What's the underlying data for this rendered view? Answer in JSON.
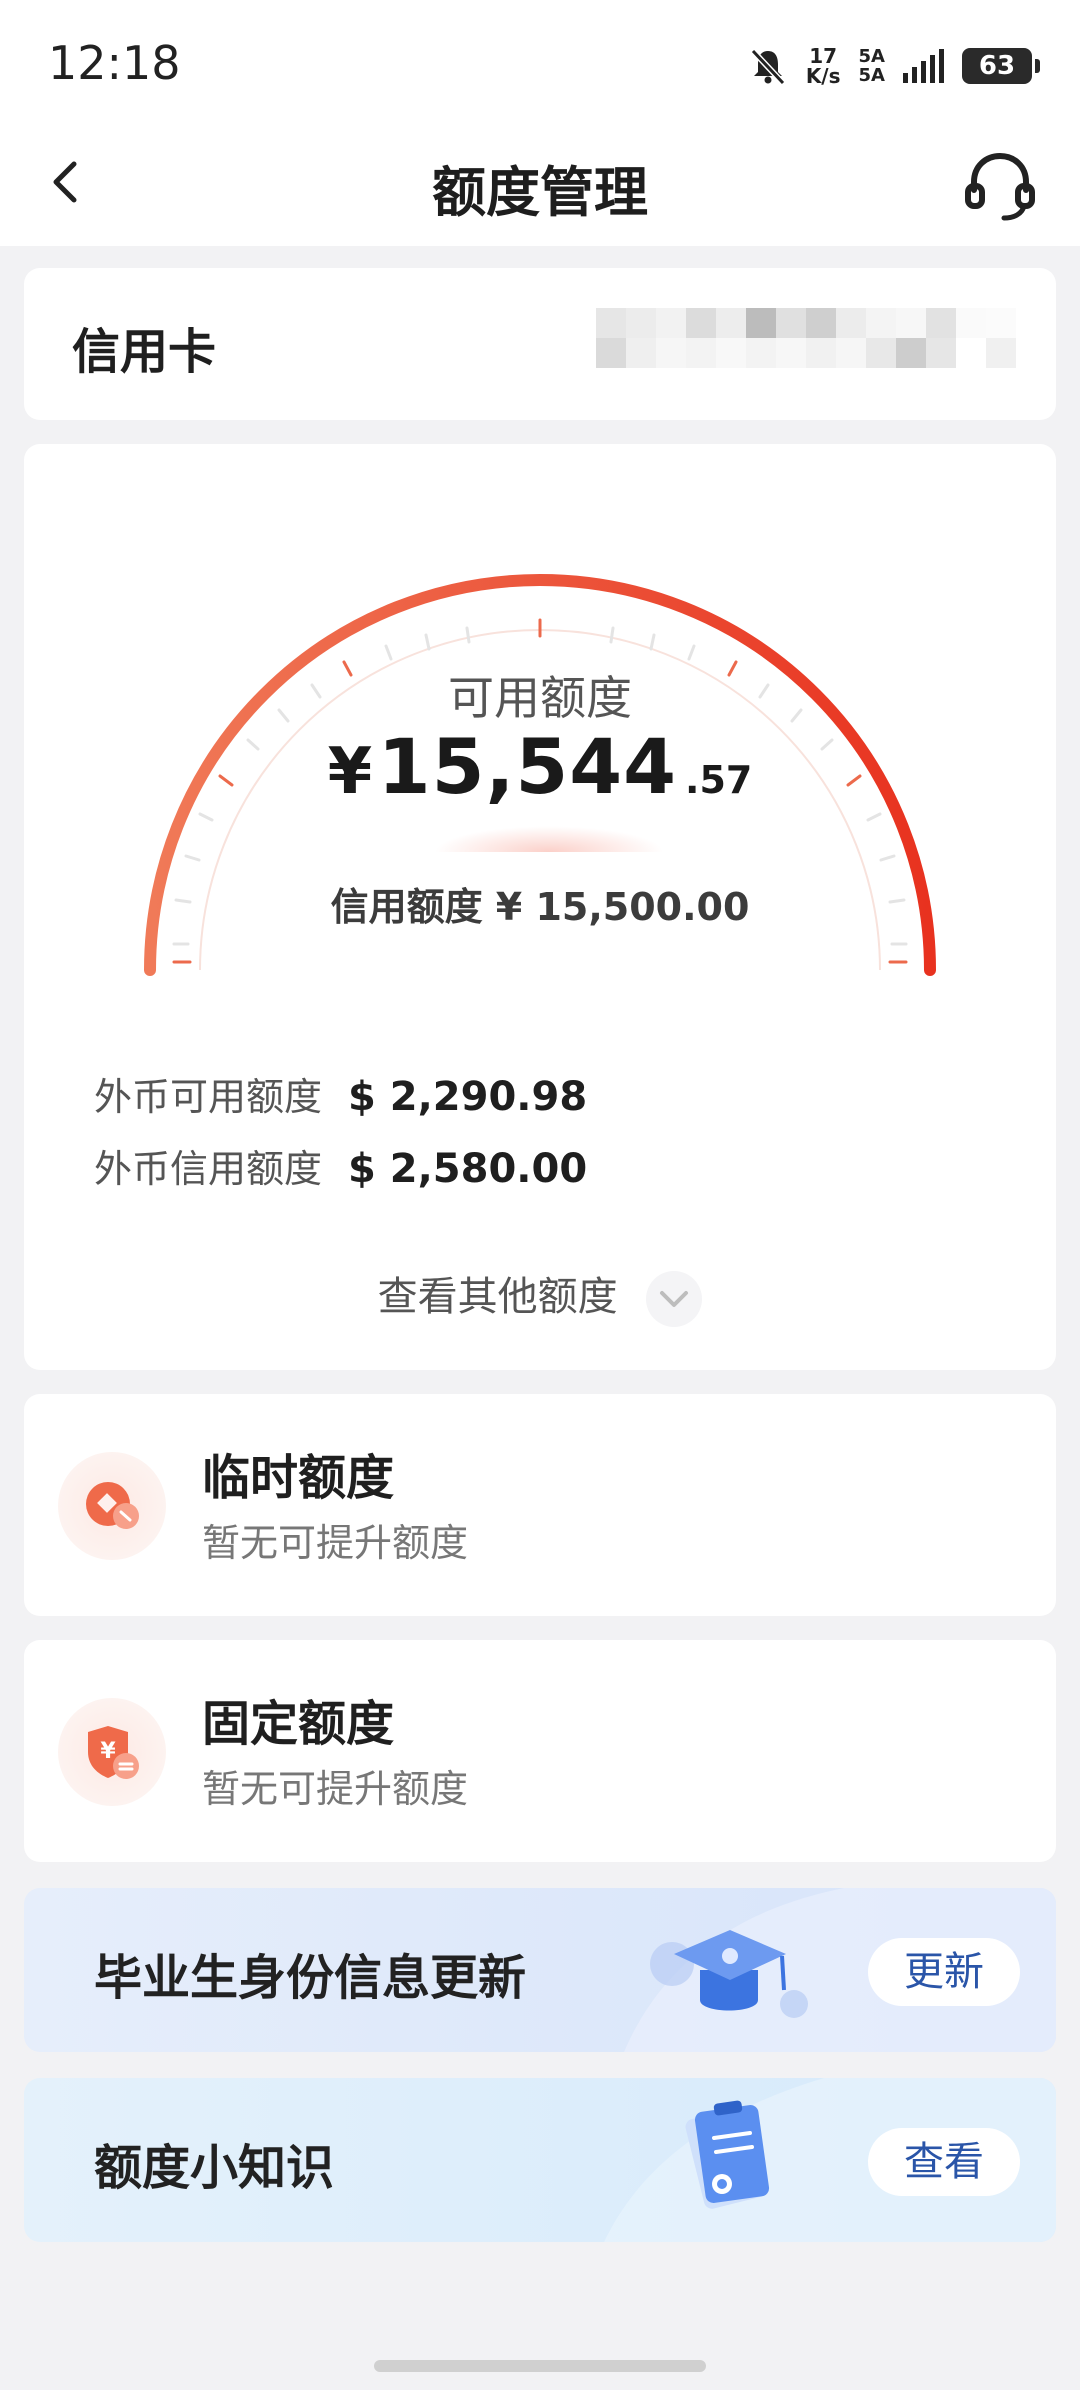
{
  "status_bar": {
    "time": "12:18",
    "net_speed_value": "17",
    "net_speed_unit": "K/s",
    "network_type_1": "5A",
    "network_type_2": "5A",
    "battery": "63",
    "icons": [
      "mute-bell-icon",
      "signal-icon",
      "battery-icon"
    ]
  },
  "header": {
    "title": "额度管理",
    "back_icon": "chevron-left-icon",
    "service_icon": "headset-icon"
  },
  "card_info": {
    "label": "信用卡"
  },
  "limit_gauge": {
    "title": "可用额度",
    "currency": "¥",
    "available_integer": "15,544",
    "available_decimal": ".57",
    "credit_limit_text": "信用额度 ¥ 15,500.00",
    "colors": {
      "arc_start": "#f07a58",
      "arc_end": "#e8321f"
    }
  },
  "foreign": {
    "available_label": "外币可用额度",
    "available_value": "$ 2,290.98",
    "credit_label": "外币信用额度",
    "credit_value": "$ 2,580.00"
  },
  "more_limits": {
    "label": "查看其他额度",
    "icon": "chevron-down-icon"
  },
  "temp_limit": {
    "title": "临时额度",
    "subtitle": "暂无可提升额度",
    "icon": "temporary-limit-icon"
  },
  "fixed_limit": {
    "title": "固定额度",
    "subtitle": "暂无可提升额度",
    "icon": "shield-yuan-icon"
  },
  "graduate_banner": {
    "text": "毕业生身份信息更新",
    "button": "更新",
    "icon": "graduation-cap-icon"
  },
  "knowledge_banner": {
    "text": "额度小知识",
    "button": "查看",
    "icon": "clipboard-icon"
  }
}
